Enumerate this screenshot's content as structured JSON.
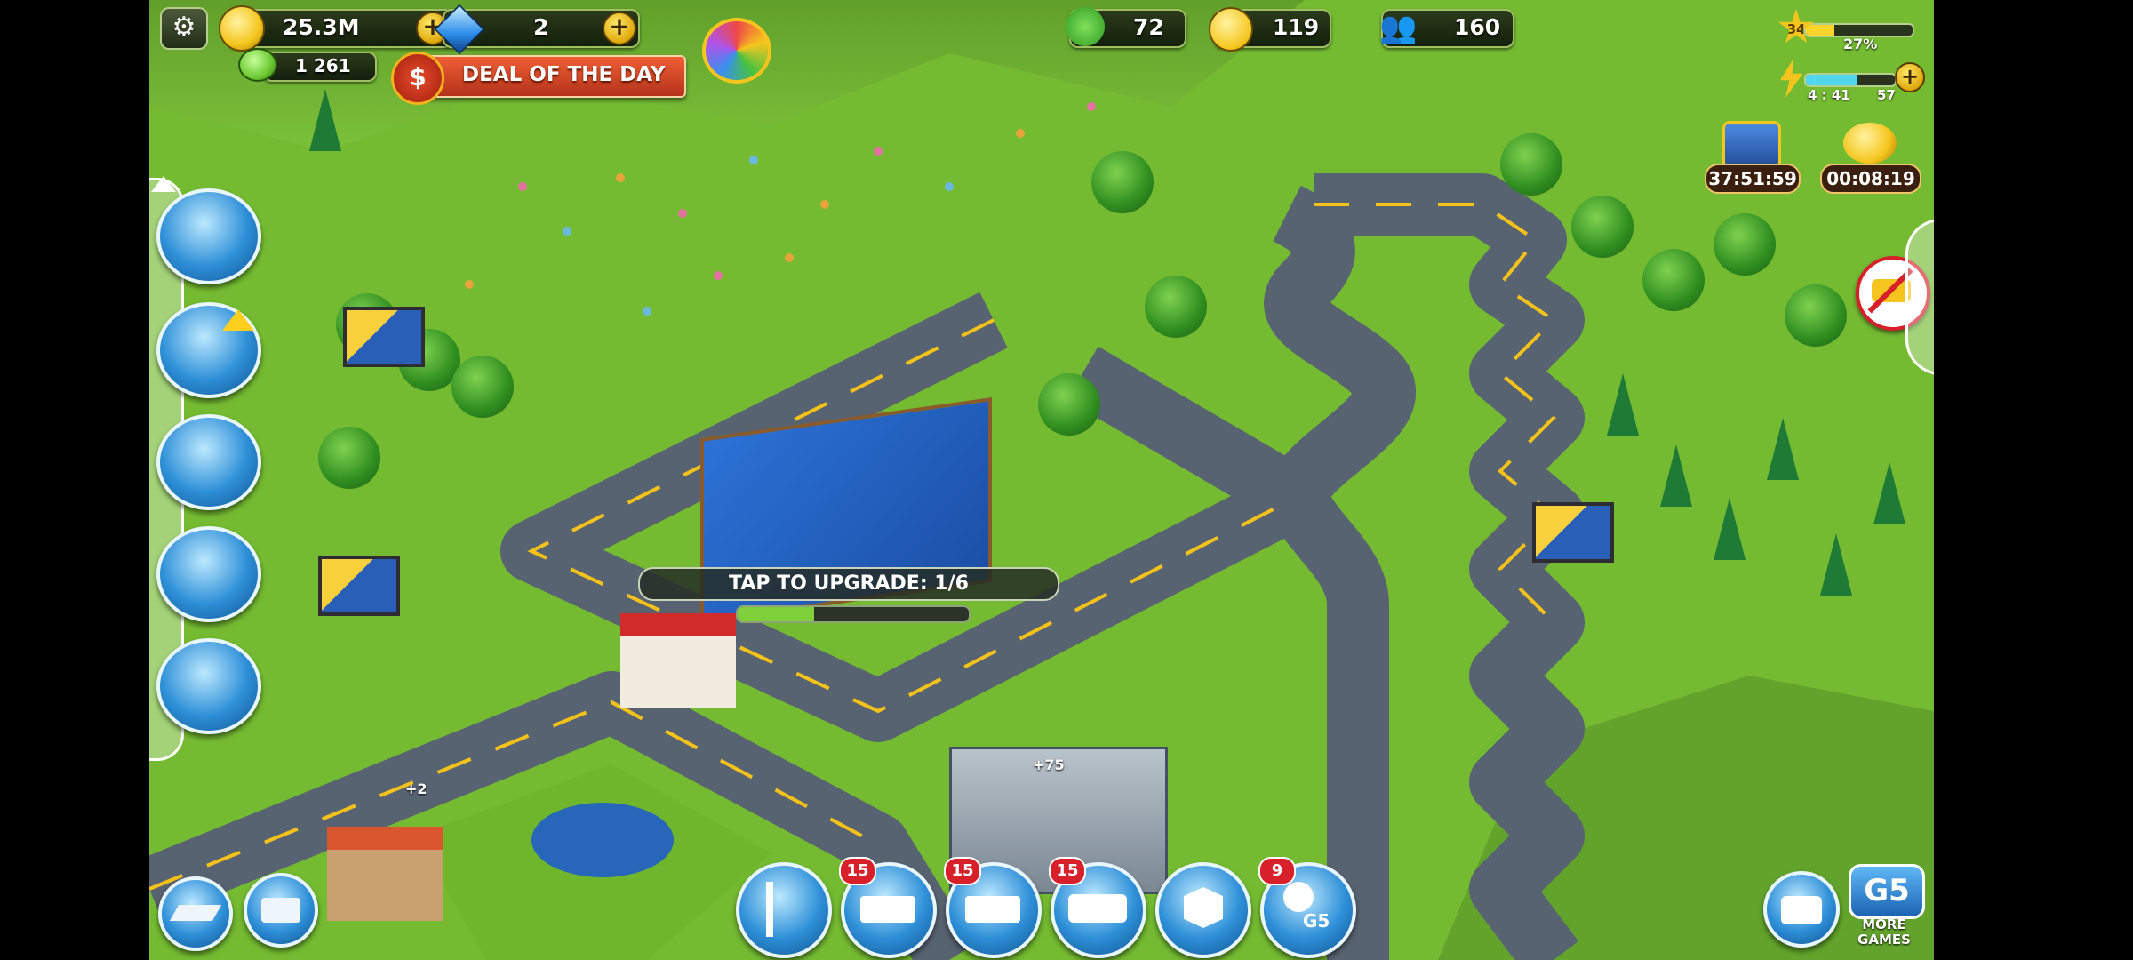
{
  "hud": {
    "coins": "25.3M",
    "diamonds": "2",
    "extra_currency": "1 261",
    "deal_label": "DEAL OF THE DAY",
    "ecology": "72",
    "happiness": "119",
    "population": "160",
    "level": "34",
    "xp_percent": "27%",
    "xp_fraction": 0.27,
    "energy_timer": "4 : 41",
    "energy_value": "57",
    "energy_fraction": 0.57,
    "chest_timer": "37:51:59",
    "gold_timer": "00:08:19"
  },
  "world": {
    "upgrade_label": "TAP TO UPGRADE: 1/6",
    "upgrade_progress": 0.33,
    "house_bonus": "+75",
    "farm_bonus": "+2"
  },
  "bottom_toolbar": {
    "truck_badge": "15",
    "recycle_badge": "15",
    "bus_badge": "15",
    "social_badge": "9",
    "g5_label": "G5",
    "more_games_label": "MORE\nGAMES"
  },
  "colors": {
    "grass": "#6fb62c",
    "road": "#586371",
    "deal": "#d9472a",
    "button_blue": "#2d8fd8"
  }
}
